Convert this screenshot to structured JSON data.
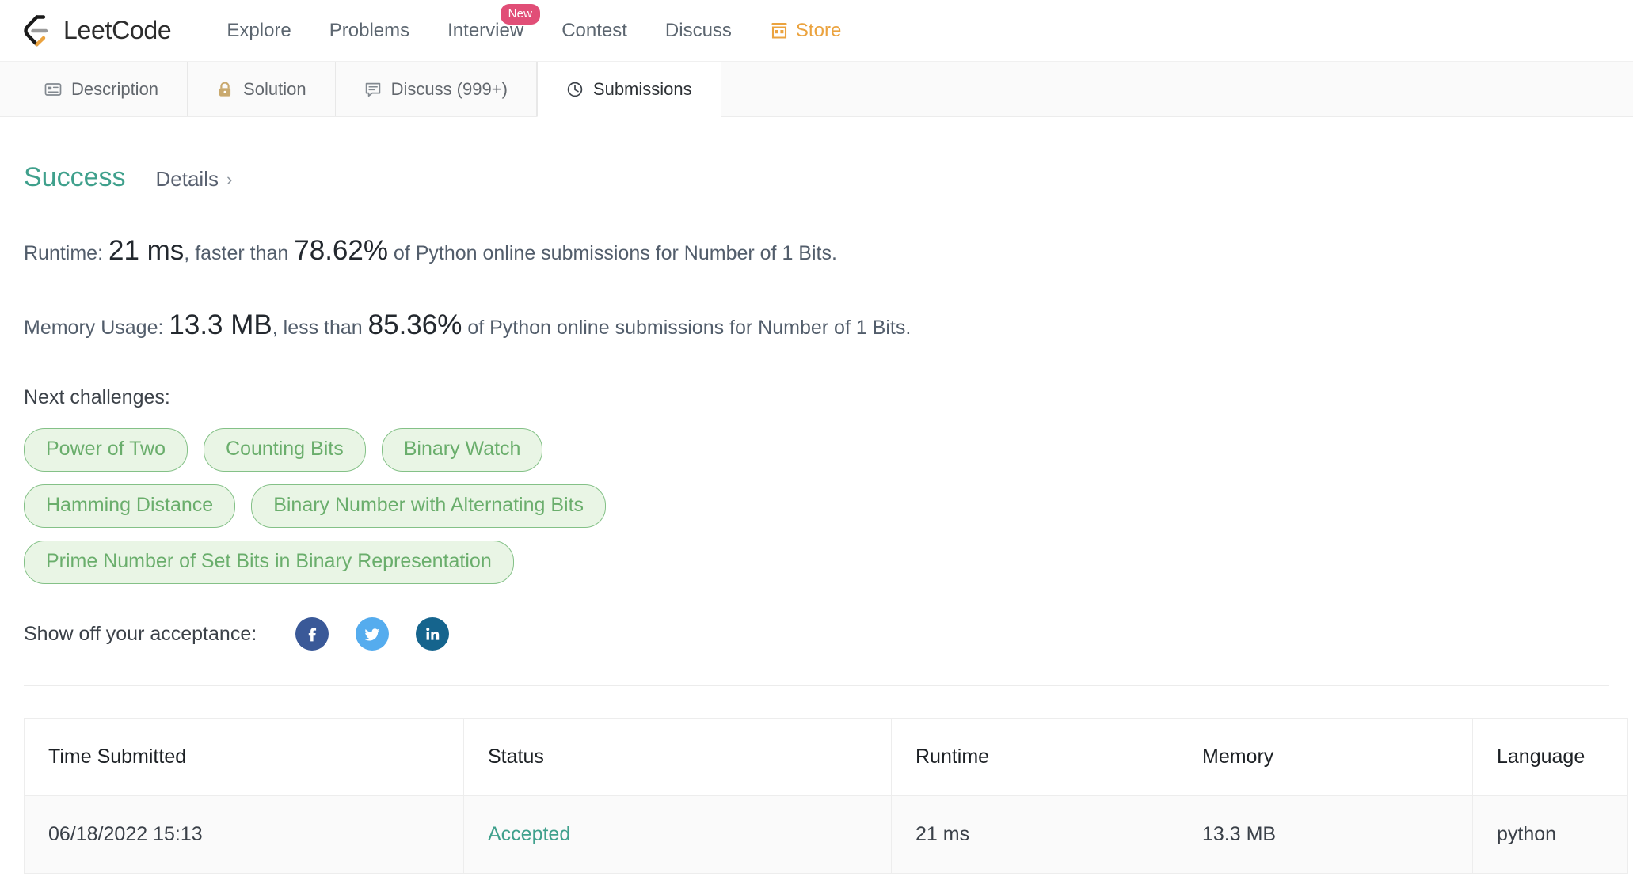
{
  "topnav": {
    "brand": "LeetCode",
    "brand_logo_icon": "leetcode-logo",
    "links": [
      {
        "label": "Explore",
        "badge": null,
        "icon": null
      },
      {
        "label": "Problems",
        "badge": null,
        "icon": null
      },
      {
        "label": "Interview",
        "badge": "New",
        "icon": null
      },
      {
        "label": "Contest",
        "badge": null,
        "icon": null
      },
      {
        "label": "Discuss",
        "badge": null,
        "icon": null
      },
      {
        "label": "Store",
        "badge": null,
        "icon": "store-icon"
      }
    ],
    "store_color": "#eba33f",
    "new_badge_color": "#e14e77"
  },
  "tabs": [
    {
      "label": "Description",
      "icon": "description-icon",
      "active": false
    },
    {
      "label": "Solution",
      "icon": "lock-icon",
      "active": false
    },
    {
      "label": "Discuss (999+)",
      "icon": "comment-icon",
      "active": false
    },
    {
      "label": "Submissions",
      "icon": "clock-icon",
      "active": true
    }
  ],
  "result": {
    "status": "Success",
    "status_color": "#3fa08c",
    "details_label": "Details",
    "details_chevron": "›",
    "runtime": {
      "prefix": "Runtime: ",
      "value": "21 ms",
      "mid": ", faster than ",
      "percent": "78.62%",
      "suffix": " of Python online submissions for Number of 1 Bits."
    },
    "memory": {
      "prefix": "Memory Usage: ",
      "value": "13.3 MB",
      "mid": ", less than ",
      "percent": "85.36%",
      "suffix": " of Python online submissions for Number of 1 Bits."
    }
  },
  "next_challenges": {
    "label": "Next challenges:",
    "pill_bg": "#e9f5e5",
    "pill_border": "#84c187",
    "pill_text": "#6aae6c",
    "rows": [
      [
        "Power of Two",
        "Counting Bits",
        "Binary Watch"
      ],
      [
        "Hamming Distance",
        "Binary Number with Alternating Bits"
      ],
      [
        "Prime Number of Set Bits in Binary Representation"
      ]
    ]
  },
  "share": {
    "label": "Show off your acceptance:",
    "buttons": [
      {
        "name": "facebook-share-button",
        "icon": "facebook-icon",
        "color": "#3a5998"
      },
      {
        "name": "twitter-share-button",
        "icon": "twitter-icon",
        "color": "#55acee"
      },
      {
        "name": "linkedin-share-button",
        "icon": "linkedin-icon",
        "color": "#15648d"
      }
    ]
  },
  "submissions_table": {
    "headers": [
      "Time Submitted",
      "Status",
      "Runtime",
      "Memory",
      "Language"
    ],
    "rows": [
      {
        "time_submitted": "06/18/2022 15:13",
        "status": "Accepted",
        "status_color": "#3fa08c",
        "runtime": "21 ms",
        "memory": "13.3 MB",
        "language": "python"
      }
    ]
  }
}
